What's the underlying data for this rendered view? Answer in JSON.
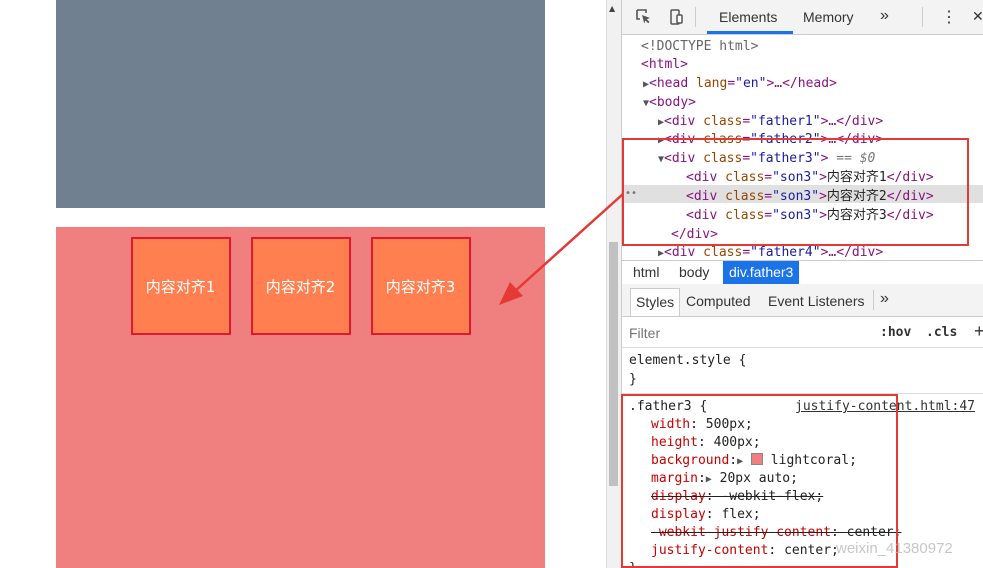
{
  "page": {
    "boxes": [
      "内容对齐1",
      "内容对齐2",
      "内容对齐3"
    ],
    "colors": {
      "father2": "#708090",
      "father3": "#f08080",
      "son3": "#ff7f50",
      "son_border": "#e0192d",
      "annotation": "#e53935"
    }
  },
  "devtools": {
    "tabs": {
      "elements": "Elements",
      "memory": "Memory",
      "more": "»"
    },
    "menu": "⋮",
    "close": "✕",
    "dom": {
      "doctype": "<!DOCTYPE html>",
      "html": "<html>",
      "head": {
        "open": "<head",
        "attr": "lang",
        "val": "\"en\"",
        "rest": ">…</head>"
      },
      "body": "<body>",
      "father1": {
        "cls": "\"father1\"",
        "rest": ">…</div>"
      },
      "father2": {
        "cls": "\"father2\"",
        "rest": ">…</div>"
      },
      "father3": {
        "cls": "\"father3\"",
        "sel": " == $0"
      },
      "son": {
        "cls": "\"son3\"",
        "texts": [
          "内容对齐1",
          "内容对齐2",
          "内容对齐3"
        ],
        "close": "</div>"
      },
      "father3_close": "</div>",
      "father4": {
        "cls": "\"father4\"",
        "rest": ">…</div>"
      },
      "div_open": "<div",
      "class_attr": "class",
      "eq": "="
    },
    "breadcrumbs": {
      "html": "html",
      "body": "body",
      "active": "div.father3"
    },
    "subtabs": {
      "styles": "Styles",
      "computed": "Computed",
      "events": "Event Listeners",
      "more": "»"
    },
    "filter": {
      "placeholder": "Filter",
      "hov": ":hov",
      "cls": ".cls",
      "add": "+"
    },
    "styles": {
      "element_style": "element.style {",
      "close_brace": "}",
      "selector": ".father3 {",
      "source": "justify-content.html:47",
      "rules": [
        {
          "prop": "width",
          "value": "500px;"
        },
        {
          "prop": "height",
          "value": "400px;"
        },
        {
          "prop": "background",
          "value": "lightcoral;"
        },
        {
          "prop": "margin",
          "value": "20px auto;"
        },
        {
          "prop": "display",
          "value": "-webkit-flex;"
        },
        {
          "prop": "display",
          "value": "flex;"
        },
        {
          "prop": "-webkit-justify-content",
          "value": "center;"
        },
        {
          "prop": "justify-content",
          "value": "center;"
        }
      ]
    },
    "watermark": "weixin_41380972"
  }
}
